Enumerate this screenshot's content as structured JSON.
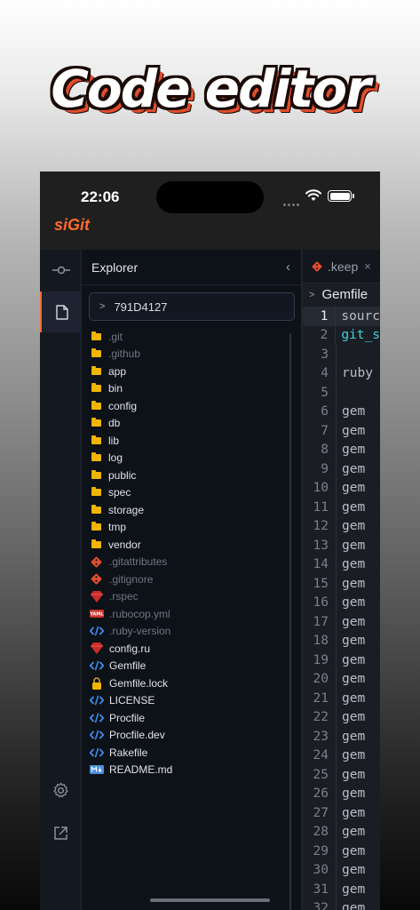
{
  "promo": {
    "title": "Code editor"
  },
  "status": {
    "time": "22:06"
  },
  "app": {
    "title": "siGit"
  },
  "explorer": {
    "title": "Explorer",
    "collapse_icon": "chevron-left-icon",
    "branch": "791D4127",
    "items": [
      {
        "name": ".git",
        "type": "folder",
        "dim": true
      },
      {
        "name": ".github",
        "type": "folder",
        "dim": true
      },
      {
        "name": "app",
        "type": "folder",
        "dim": false
      },
      {
        "name": "bin",
        "type": "folder",
        "dim": false
      },
      {
        "name": "config",
        "type": "folder",
        "dim": false
      },
      {
        "name": "db",
        "type": "folder",
        "dim": false
      },
      {
        "name": "lib",
        "type": "folder",
        "dim": false
      },
      {
        "name": "log",
        "type": "folder",
        "dim": false
      },
      {
        "name": "public",
        "type": "folder",
        "dim": false
      },
      {
        "name": "spec",
        "type": "folder",
        "dim": false
      },
      {
        "name": "storage",
        "type": "folder",
        "dim": false
      },
      {
        "name": "tmp",
        "type": "folder",
        "dim": false
      },
      {
        "name": "vendor",
        "type": "folder",
        "dim": false
      },
      {
        "name": ".gitattributes",
        "type": "git",
        "dim": true
      },
      {
        "name": ".gitignore",
        "type": "git",
        "dim": true
      },
      {
        "name": ".rspec",
        "type": "ruby",
        "dim": true
      },
      {
        "name": ".rubocop.yml",
        "type": "yaml",
        "dim": true
      },
      {
        "name": ".ruby-version",
        "type": "code",
        "dim": true
      },
      {
        "name": "config.ru",
        "type": "ruby",
        "dim": false
      },
      {
        "name": "Gemfile",
        "type": "code",
        "dim": false
      },
      {
        "name": "Gemfile.lock",
        "type": "lock",
        "dim": false
      },
      {
        "name": "LICENSE",
        "type": "code",
        "dim": false
      },
      {
        "name": "Procfile",
        "type": "code",
        "dim": false
      },
      {
        "name": "Procfile.dev",
        "type": "code",
        "dim": false
      },
      {
        "name": "Rakefile",
        "type": "code",
        "dim": false
      },
      {
        "name": "README.md",
        "type": "markdown",
        "dim": false
      }
    ]
  },
  "editor": {
    "tab": {
      "label": ".keep",
      "icon": "git-icon",
      "close": "×"
    },
    "breadcrumb": "Gemfile",
    "current_line": 1,
    "lines": [
      {
        "n": "1",
        "text": "sourc",
        "style": "plain"
      },
      {
        "n": "2",
        "text": "git_s",
        "style": "cyan"
      },
      {
        "n": "3",
        "text": "",
        "style": "plain"
      },
      {
        "n": "4",
        "text": "ruby",
        "style": "plain"
      },
      {
        "n": "5",
        "text": "",
        "style": "plain"
      },
      {
        "n": "6",
        "text": "gem",
        "style": "plain"
      },
      {
        "n": "7",
        "text": "gem",
        "style": "plain"
      },
      {
        "n": "8",
        "text": "gem",
        "style": "plain"
      },
      {
        "n": "9",
        "text": "gem",
        "style": "plain"
      },
      {
        "n": "10",
        "text": "gem",
        "style": "plain"
      },
      {
        "n": "11",
        "text": "gem",
        "style": "plain"
      },
      {
        "n": "12",
        "text": "gem",
        "style": "plain"
      },
      {
        "n": "13",
        "text": "gem",
        "style": "plain"
      },
      {
        "n": "14",
        "text": "gem",
        "style": "plain"
      },
      {
        "n": "15",
        "text": "gem",
        "style": "plain"
      },
      {
        "n": "16",
        "text": "gem",
        "style": "plain"
      },
      {
        "n": "17",
        "text": "gem",
        "style": "plain"
      },
      {
        "n": "18",
        "text": "gem",
        "style": "plain"
      },
      {
        "n": "19",
        "text": "gem",
        "style": "plain"
      },
      {
        "n": "20",
        "text": "gem",
        "style": "plain"
      },
      {
        "n": "21",
        "text": "gem",
        "style": "plain"
      },
      {
        "n": "22",
        "text": "gem",
        "style": "plain"
      },
      {
        "n": "23",
        "text": "gem",
        "style": "plain"
      },
      {
        "n": "24",
        "text": "gem",
        "style": "plain"
      },
      {
        "n": "25",
        "text": "gem",
        "style": "plain"
      },
      {
        "n": "26",
        "text": "gem",
        "style": "plain"
      },
      {
        "n": "27",
        "text": "gem",
        "style": "plain"
      },
      {
        "n": "28",
        "text": "gem",
        "style": "plain"
      },
      {
        "n": "29",
        "text": "gem",
        "style": "plain"
      },
      {
        "n": "30",
        "text": "gem",
        "style": "plain"
      },
      {
        "n": "31",
        "text": "gem",
        "style": "plain"
      },
      {
        "n": "32",
        "text": "gem",
        "style": "plain"
      }
    ]
  },
  "activity": {
    "items": [
      {
        "icon": "source-control-icon",
        "active": false
      },
      {
        "icon": "file-icon",
        "active": true
      },
      {
        "icon": "gear-icon",
        "active": false
      },
      {
        "icon": "external-link-icon",
        "active": false
      }
    ]
  },
  "colors": {
    "accent": "#ff6a2b",
    "folder": "#f0b500",
    "git": "#e24d2c",
    "code_icon": "#3b8eea",
    "ruby": "#cc2a28",
    "cyan_text": "#3fd3d3"
  }
}
